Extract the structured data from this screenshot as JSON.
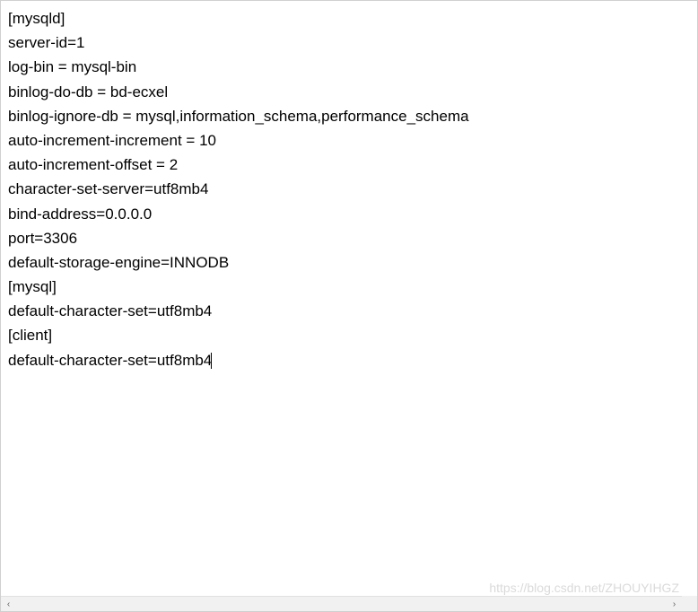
{
  "config": {
    "lines": [
      "[mysqld]",
      "server-id=1",
      "log-bin = mysql-bin",
      "binlog-do-db = bd-ecxel",
      "binlog-ignore-db = mysql,information_schema,performance_schema",
      "auto-increment-increment = 10",
      "auto-increment-offset = 2",
      "character-set-server=utf8mb4",
      "bind-address=0.0.0.0",
      "port=3306",
      "default-storage-engine=INNODB",
      "[mysql]",
      "default-character-set=utf8mb4",
      "[client]",
      "default-character-set=utf8mb4"
    ]
  },
  "watermark": "https://blog.csdn.net/ZHOUYIHGZ",
  "scroll": {
    "left_arrow": "‹",
    "right_arrow": "›"
  }
}
